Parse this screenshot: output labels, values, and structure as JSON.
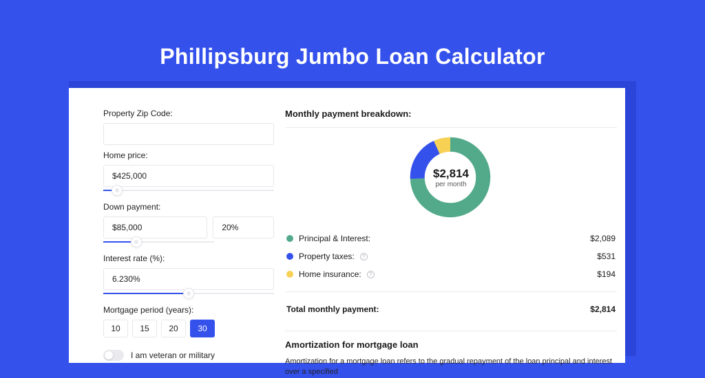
{
  "page": {
    "title": "Phillipsburg Jumbo Loan Calculator"
  },
  "colors": {
    "principal": "#53aa8a",
    "taxes": "#3551ec",
    "insurance": "#f7d154"
  },
  "form": {
    "zip_label": "Property Zip Code:",
    "zip_value": "",
    "home_price_label": "Home price:",
    "home_price_value": "$425,000",
    "home_price_slider_pct": 8,
    "down_payment_label": "Down payment:",
    "down_payment_value": "$85,000",
    "down_payment_pct_value": "20%",
    "down_payment_slider_pct": 30,
    "interest_label": "Interest rate (%):",
    "interest_value": "6.230%",
    "interest_slider_pct": 50,
    "period_label": "Mortgage period (years):",
    "periods": [
      "10",
      "15",
      "20",
      "30"
    ],
    "period_selected": "30",
    "veteran_label": "I am veteran or military",
    "veteran_on": false
  },
  "breakdown": {
    "title": "Monthly payment breakdown:",
    "total_big": "$2,814",
    "total_sub": "per month",
    "items": [
      {
        "key": "principal",
        "label": "Principal & Interest:",
        "value": "$2,089",
        "info": false
      },
      {
        "key": "taxes",
        "label": "Property taxes:",
        "value": "$531",
        "info": true
      },
      {
        "key": "insurance",
        "label": "Home insurance:",
        "value": "$194",
        "info": true
      }
    ],
    "total_label": "Total monthly payment:",
    "total_value": "$2,814"
  },
  "chart_data": {
    "type": "pie",
    "title": "Monthly payment breakdown",
    "series": [
      {
        "name": "Principal & Interest",
        "value": 2089
      },
      {
        "name": "Property taxes",
        "value": 531
      },
      {
        "name": "Home insurance",
        "value": 194
      }
    ],
    "total": 2814,
    "center_label": "$2,814",
    "center_sublabel": "per month"
  },
  "amort": {
    "title": "Amortization for mortgage loan",
    "body": "Amortization for a mortgage loan refers to the gradual repayment of the loan principal and interest over a specified"
  }
}
